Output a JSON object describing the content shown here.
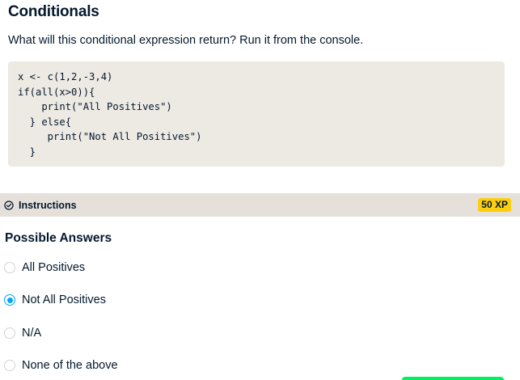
{
  "exercise": {
    "title": "Conditionals",
    "question": "What will this conditional expression return? Run it from the console."
  },
  "code": {
    "lines": [
      "x <- c(1,2,-3,4)",
      "if(all(x>0)){",
      "    print(\"All Positives\")",
      "  } else{",
      "     print(\"Not All Positives\")",
      "  }"
    ]
  },
  "instructions": {
    "label": "Instructions",
    "icon": "check-circle-icon",
    "xp": "50 XP"
  },
  "answers": {
    "heading": "Possible Answers",
    "options": [
      {
        "label": "All Positives",
        "selected": false
      },
      {
        "label": "Not All Positives",
        "selected": true
      },
      {
        "label": "N/A",
        "selected": false
      },
      {
        "label": "None of the above",
        "selected": false
      }
    ]
  },
  "colors": {
    "text": "#05192d",
    "code_bg": "#ede9e3",
    "instructions_bg": "#e5e1da",
    "xp_badge": "#fcce0d",
    "radio_selected": "#03a4f0",
    "submit_button": "#03ef62"
  }
}
